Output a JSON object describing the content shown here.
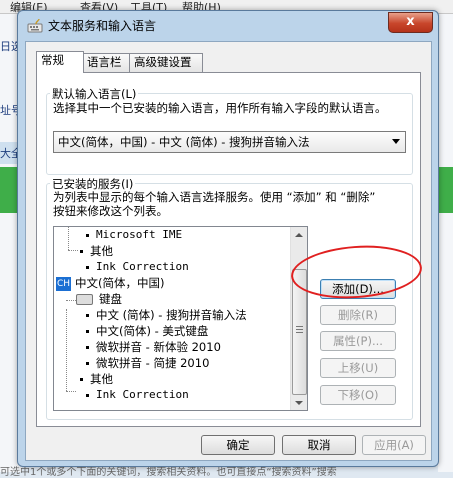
{
  "background": {
    "menu": [
      "编辑(E)",
      "查看(V)",
      "工具(T)",
      "帮助(H)"
    ],
    "left_fragments": [
      "日选",
      "址号",
      "大全"
    ],
    "bottom_text": "可选中1个或多个下面的关键词，搜索相关资料。也可直接点“搜索资料”搜索"
  },
  "dialog": {
    "title": "文本服务和输入语言",
    "close": "x",
    "tabs": [
      {
        "label": "常规",
        "active": true
      },
      {
        "label": "语言栏",
        "active": false
      },
      {
        "label": "高级键设置",
        "active": false
      }
    ],
    "default_group": {
      "label": "默认输入语言(L)",
      "description": "选择其中一个已安装的输入语言，用作所有输入字段的默认语言。",
      "selected": "中文(简体，中国) - 中文 (简体) - 搜狗拼音输入法"
    },
    "installed_group": {
      "label": "已安装的服务(I)",
      "description_line1": "为列表中显示的每个输入语言选择服务。使用 “添加” 和 “删除”",
      "description_line2": "按钮来修改这个列表。"
    },
    "tree": [
      {
        "text": "Microsoft IME",
        "type": "item",
        "mono": true
      },
      {
        "text": "其他",
        "type": "category"
      },
      {
        "text": "Ink Correction",
        "type": "item",
        "mono": true
      },
      {
        "text": "中文(简体，中国)",
        "type": "language",
        "icon": "CH"
      },
      {
        "text": "键盘",
        "type": "category",
        "icon": "keyboard"
      },
      {
        "text": "中文 (简体) - 搜狗拼音输入法",
        "type": "item"
      },
      {
        "text": "中文(简体) - 美式键盘",
        "type": "item"
      },
      {
        "text": "微软拼音 - 新体验 2010",
        "type": "item"
      },
      {
        "text": "微软拼音 - 简捷 2010",
        "type": "item"
      },
      {
        "text": "其他",
        "type": "category"
      },
      {
        "text": "Ink Correction",
        "type": "item",
        "mono": true
      }
    ],
    "side_buttons": [
      {
        "label": "添加(D)...",
        "enabled": true
      },
      {
        "label": "删除(R)",
        "enabled": false
      },
      {
        "label": "属性(P)...",
        "enabled": false
      },
      {
        "label": "上移(U)",
        "enabled": false
      },
      {
        "label": "下移(O)",
        "enabled": false
      }
    ],
    "footer": {
      "ok": "确定",
      "cancel": "取消",
      "apply": "应用(A)"
    },
    "annotation_color": "#e02020"
  }
}
